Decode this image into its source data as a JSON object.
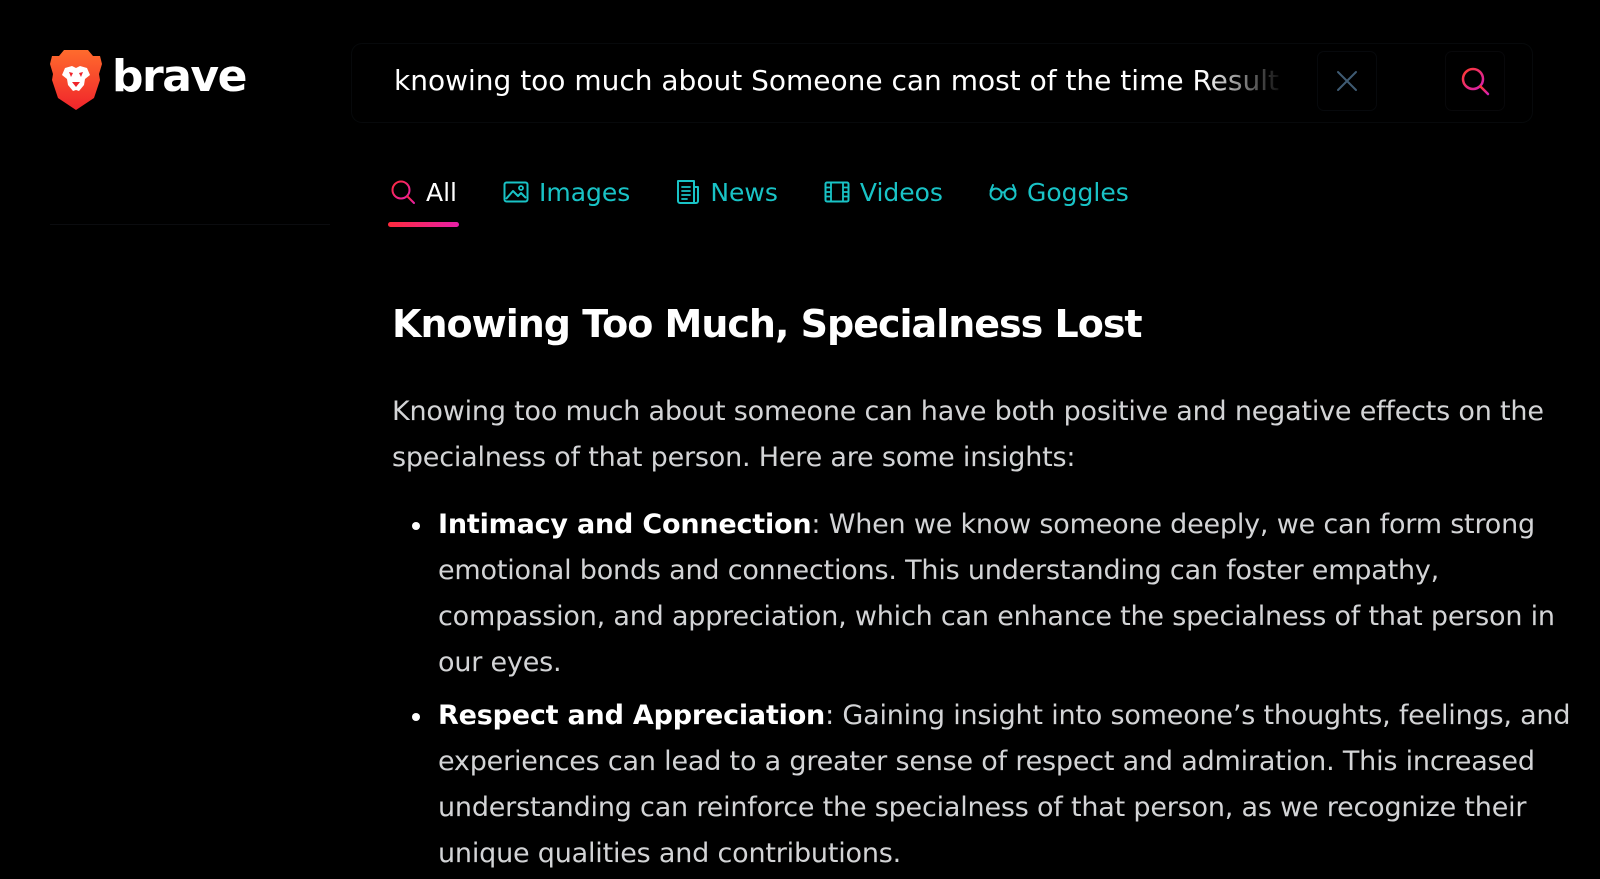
{
  "brand": {
    "name": "brave",
    "logo_icon": "brave-lion-icon",
    "logo_color": "#fb542b"
  },
  "search": {
    "query": "knowing too much about Someone can most of the time Result in a loss of specialness",
    "clear_icon": "close-icon",
    "submit_icon": "search-icon"
  },
  "tabs": [
    {
      "label": "All",
      "icon": "search-icon",
      "active": true
    },
    {
      "label": "Images",
      "icon": "image-icon",
      "active": false
    },
    {
      "label": "News",
      "icon": "newspaper-icon",
      "active": false
    },
    {
      "label": "Videos",
      "icon": "film-icon",
      "active": false
    },
    {
      "label": "Goggles",
      "icon": "goggles-icon",
      "active": false
    }
  ],
  "answer": {
    "title": "Knowing Too Much, Specialness Lost",
    "intro": "Knowing too much about someone can have both positive and negative effects on the specialness of that person. Here are some insights:",
    "items": [
      {
        "title": "Intimacy and Connection",
        "text": ": When we know someone deeply, we can form strong emotional bonds and connections. This understanding can foster empathy, compassion, and appreciation, which can enhance the specialness of that person in our eyes."
      },
      {
        "title": "Respect and Appreciation",
        "text": ": Gaining insight into someone’s thoughts, feelings, and experiences can lead to a greater sense of respect and admiration. This increased understanding can reinforce the specialness of that person, as we recognize their unique qualities and contributions."
      }
    ]
  },
  "colors": {
    "background": "#000000",
    "tab_text": "#19c3c6",
    "active_underline_start": "#ff2a3c",
    "active_underline_end": "#e81fa8",
    "body_text": "#d3d4d6"
  }
}
